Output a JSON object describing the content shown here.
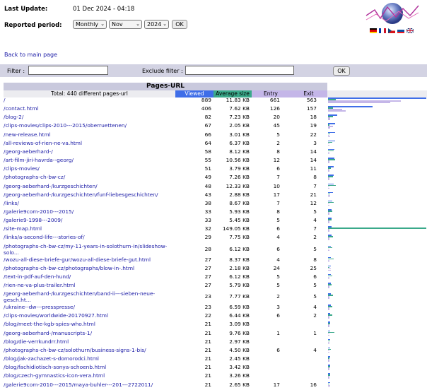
{
  "header": {
    "last_update_label": "Last Update:",
    "last_update_value": "01 Dec 2024 - 04:18",
    "reported_period_label": "Reported period:",
    "period_type": "Monthly",
    "month": "Nov",
    "year": "2024",
    "ok_label": "OK"
  },
  "nav": {
    "back_label": "Back to main page"
  },
  "filters": {
    "filter_label": "Filter :",
    "exclude_label": "Exclude filter :",
    "filter_value": "",
    "exclude_value": "",
    "ok_label": "OK"
  },
  "table": {
    "title": "Pages-URL",
    "total_label": "Total: 440 different pages-url",
    "col_viewed": "Viewed",
    "col_avg": "Average size",
    "col_entry": "Entry",
    "col_exit": "Exit",
    "colors": {
      "viewed": "#3f6ee8",
      "avg": "#3aa98a",
      "entry": "#c4b6e8",
      "exit": "#c4b6e8"
    },
    "rows": [
      {
        "url": "/",
        "viewed": "889",
        "avg": "11.83 KB",
        "entry": "661",
        "exit": "563"
      },
      {
        "url": "/contact.html",
        "viewed": "406",
        "avg": "7.62 KB",
        "entry": "126",
        "exit": "157"
      },
      {
        "url": "/blog-2/",
        "viewed": "82",
        "avg": "7.23 KB",
        "entry": "20",
        "exit": "18"
      },
      {
        "url": "/clips-movies/clips-2010---2015/oberruettenen/",
        "viewed": "67",
        "avg": "2.05 KB",
        "entry": "45",
        "exit": "19"
      },
      {
        "url": "/new-release.html",
        "viewed": "66",
        "avg": "3.01 KB",
        "entry": "5",
        "exit": "22"
      },
      {
        "url": "/all-reviews-of-rien-ne-va.html",
        "viewed": "64",
        "avg": "6.37 KB",
        "entry": "2",
        "exit": "3"
      },
      {
        "url": "/georg-aeberhard-/",
        "viewed": "58",
        "avg": "8.12 KB",
        "entry": "8",
        "exit": "14"
      },
      {
        "url": "/art-film-jiri-havrda--georg/",
        "viewed": "55",
        "avg": "10.56 KB",
        "entry": "12",
        "exit": "14"
      },
      {
        "url": "/clips-movies/",
        "viewed": "51",
        "avg": "3.79 KB",
        "entry": "6",
        "exit": "11"
      },
      {
        "url": "/photographs-ch-bw-cz/",
        "viewed": "49",
        "avg": "7.26 KB",
        "entry": "7",
        "exit": "8"
      },
      {
        "url": "/georg-aeberhard-/kurzgeschichten/",
        "viewed": "48",
        "avg": "12.33 KB",
        "entry": "10",
        "exit": "7"
      },
      {
        "url": "/georg-aeberhard-/kurzgeschichten/funf-liebesgeschichten/",
        "viewed": "43",
        "avg": "2.88 KB",
        "entry": "17",
        "exit": "21"
      },
      {
        "url": "/links/",
        "viewed": "38",
        "avg": "8.67 KB",
        "entry": "7",
        "exit": "12"
      },
      {
        "url": "/galerie9com-2010---2015/",
        "viewed": "33",
        "avg": "5.93 KB",
        "entry": "8",
        "exit": "5"
      },
      {
        "url": "/galerie9-1998---2009/",
        "viewed": "33",
        "avg": "5.45 KB",
        "entry": "5",
        "exit": "4"
      },
      {
        "url": "/site-map.html",
        "viewed": "32",
        "avg": "149.05 KB",
        "entry": "6",
        "exit": "7"
      },
      {
        "url": "/links/a-second-life---stories-of/",
        "viewed": "29",
        "avg": "7.75 KB",
        "entry": "4",
        "exit": "2"
      },
      {
        "url": "/photographs-ch-bw-cz/my-11-years-in-solothurn-in/slideshow-solo...",
        "viewed": "28",
        "avg": "6.12 KB",
        "entry": "6",
        "exit": "5"
      },
      {
        "url": "/wozu-all-diese-briefe-gur/wozu-all-diese-briefe-gut.html",
        "viewed": "27",
        "avg": "8.37 KB",
        "entry": "4",
        "exit": "8"
      },
      {
        "url": "/photographs-ch-bw-cz/photographs/blow-in-.html",
        "viewed": "27",
        "avg": "2.18 KB",
        "entry": "24",
        "exit": "25"
      },
      {
        "url": "/text-in-pdf-auf-den-hund/",
        "viewed": "27",
        "avg": "6.12 KB",
        "entry": "5",
        "exit": "6"
      },
      {
        "url": "/rien-ne-va-plus-trailer.html",
        "viewed": "27",
        "avg": "5.79 KB",
        "entry": "5",
        "exit": "5"
      },
      {
        "url": "/georg-aeberhard-/kurzgeschichten/band-ii---sieben-neue-gesch.ht...",
        "viewed": "23",
        "avg": "7.77 KB",
        "entry": "2",
        "exit": "5"
      },
      {
        "url": "/ukraine--dw---presspresse/",
        "viewed": "23",
        "avg": "6.59 KB",
        "entry": "3",
        "exit": "4"
      },
      {
        "url": "/clips-movies/worldwide-20170927.html",
        "viewed": "22",
        "avg": "6.44 KB",
        "entry": "6",
        "exit": "2"
      },
      {
        "url": "/blog/meet-the-kgb-spies-who.html",
        "viewed": "21",
        "avg": "3.09 KB",
        "entry": "",
        "exit": ""
      },
      {
        "url": "/georg-aeberhard-/manuscripts-1/",
        "viewed": "21",
        "avg": "9.76 KB",
        "entry": "1",
        "exit": "1"
      },
      {
        "url": "/blog/die-verrkundrr.html",
        "viewed": "21",
        "avg": "2.97 KB",
        "entry": "",
        "exit": ""
      },
      {
        "url": "/photographs-ch-bw-cz/solothurn/business-signs-1-bis/",
        "viewed": "21",
        "avg": "4.50 KB",
        "entry": "6",
        "exit": "4"
      },
      {
        "url": "/blog/jak-zachazet-s-domorodci.html",
        "viewed": "21",
        "avg": "2.45 KB",
        "entry": "",
        "exit": ""
      },
      {
        "url": "/blog/fachidiotisch-sonya-schoenb.html",
        "viewed": "21",
        "avg": "3.42 KB",
        "entry": "",
        "exit": ""
      },
      {
        "url": "/blog/czech-gymnastics-icon-vera.html",
        "viewed": "21",
        "avg": "3.26 KB",
        "entry": "",
        "exit": ""
      },
      {
        "url": "/galerie9com-2010---2015/maya-buhler---201---2722011/",
        "viewed": "21",
        "avg": "2.65 KB",
        "entry": "17",
        "exit": "16"
      }
    ]
  }
}
